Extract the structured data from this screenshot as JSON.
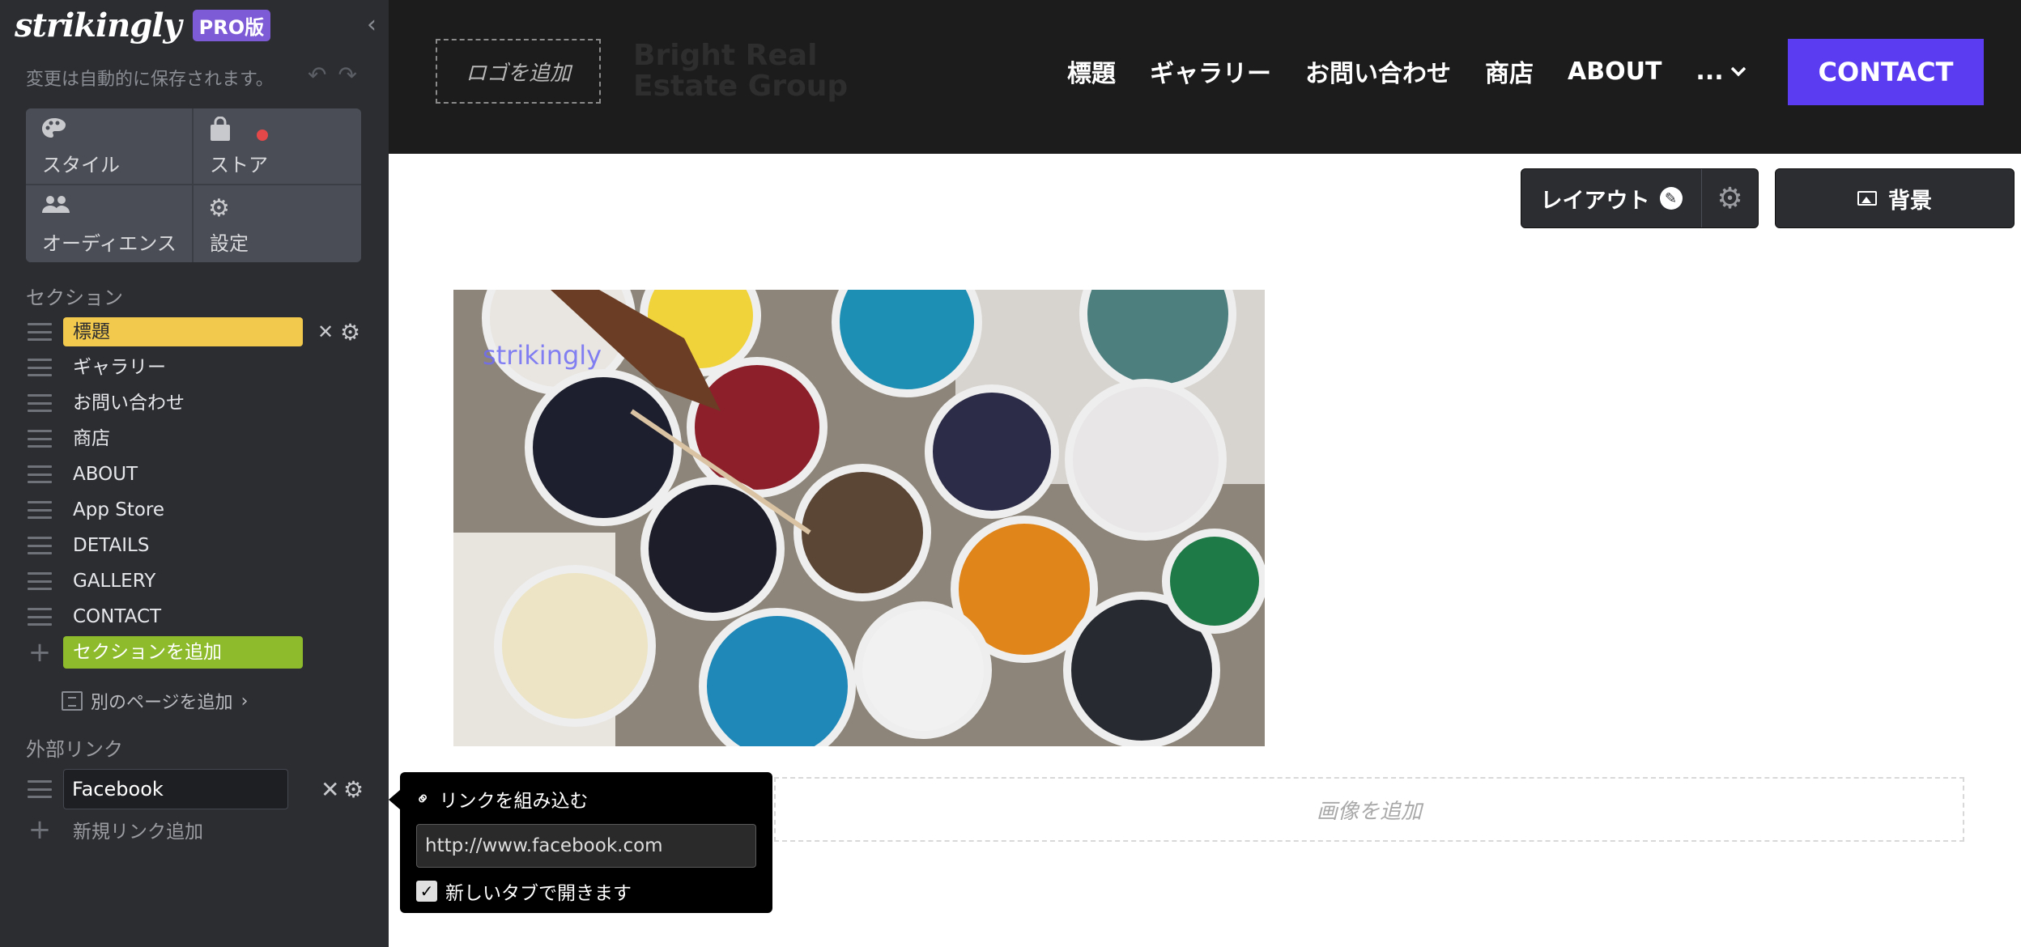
{
  "sidebar": {
    "brand": "strikingly",
    "badge": "PRO版",
    "autosave": "変更は自動的に保存されます。",
    "tools": [
      {
        "label": "スタイル"
      },
      {
        "label": "ストア"
      },
      {
        "label": "オーディエンス"
      },
      {
        "label": "設定"
      }
    ],
    "sections_heading": "セクション",
    "sections": [
      "標題",
      "ギャラリー",
      "お問い合わせ",
      "商店",
      "ABOUT",
      "App Store",
      "DETAILS",
      "GALLERY",
      "CONTACT"
    ],
    "add_section": "セクションを追加",
    "add_page": "別のページを追加",
    "external_heading": "外部リンク",
    "external_link_value": "Facebook",
    "new_link": "新規リンク追加"
  },
  "topnav": {
    "logo_placeholder": "ロゴを追加",
    "site_name": "Bright Real Estate Group",
    "items": [
      "標題",
      "ギャラリー",
      "お問い合わせ",
      "商店",
      "ABOUT"
    ],
    "more": "...",
    "contact": "CONTACT"
  },
  "canvas": {
    "layout_btn": "レイアウト",
    "background_btn": "背景",
    "watermark": "strikingly",
    "add_image": "画像を追加"
  },
  "popover": {
    "title": "リンクを組み込む",
    "url": "http://www.facebook.com",
    "new_tab_label": "新しいタブで開きます",
    "new_tab_checked": true
  },
  "colors": {
    "sidebar_bg": "#2b2d31",
    "active_section": "#f2c94c",
    "add_section": "#8dbb2c",
    "contact_button": "#5b3cf0",
    "badge": "#7e5bd6",
    "store_dot": "#e54848"
  },
  "icons": [
    "palette-icon",
    "bag-icon",
    "people-icon",
    "gear-icon",
    "undo-icon",
    "redo-icon",
    "drag-handle-icon",
    "close-icon",
    "plus-icon",
    "page-icon",
    "chevron-right-icon",
    "chevron-down-icon",
    "pencil-icon",
    "image-icon",
    "link-icon",
    "check-icon",
    "collapse-icon"
  ]
}
